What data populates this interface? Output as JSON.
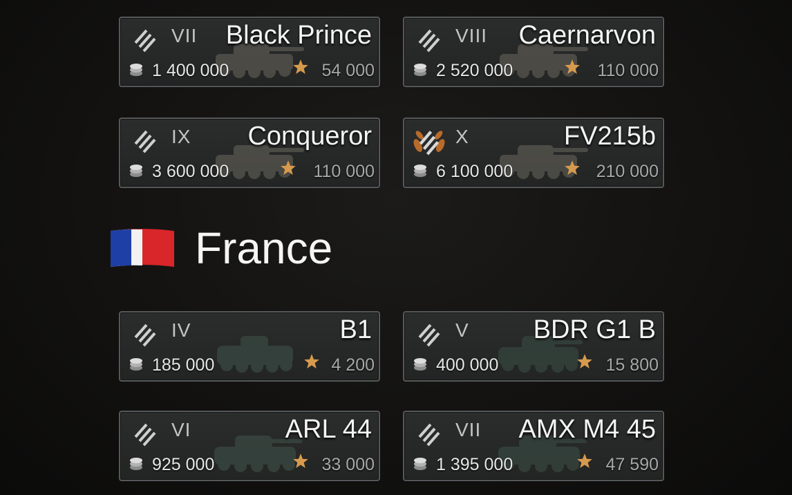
{
  "vehicles": [
    {
      "tier": "VII",
      "name": "Black Prince",
      "price": "1 400 000",
      "xp": "54 000",
      "elite": false,
      "color": "#5c5a52"
    },
    {
      "tier": "VIII",
      "name": "Caernarvon",
      "price": "2 520 000",
      "xp": "110 000",
      "elite": false,
      "color": "#5e5c53"
    },
    {
      "tier": "IX",
      "name": "Conqueror",
      "price": "3 600 000",
      "xp": "110 000",
      "elite": false,
      "color": "#5b5a52"
    },
    {
      "tier": "X",
      "name": "FV215b",
      "price": "6 100 000",
      "xp": "210 000",
      "elite": true,
      "color": "#5d5b53"
    }
  ],
  "section": {
    "title": "France",
    "flag_colors": [
      "#1d3fa6",
      "#f2f2f2",
      "#d8262a"
    ]
  },
  "france_vehicles": [
    {
      "tier": "IV",
      "name": "B1",
      "price": "185 000",
      "xp": "4 200",
      "color": "#3a4a44"
    },
    {
      "tier": "V",
      "name": "BDR G1 B",
      "price": "400 000",
      "xp": "15 800",
      "color": "#37473f"
    },
    {
      "tier": "VI",
      "name": "ARL 44",
      "price": "925 000",
      "xp": "33 000",
      "color": "#3b4b44"
    },
    {
      "tier": "VII",
      "name": "AMX M4 45",
      "price": "1 395 000",
      "xp": "47 590",
      "color": "#384841"
    }
  ],
  "theme": {
    "star_color": "#d79a4c",
    "laurel_color": "#b86b2a"
  }
}
